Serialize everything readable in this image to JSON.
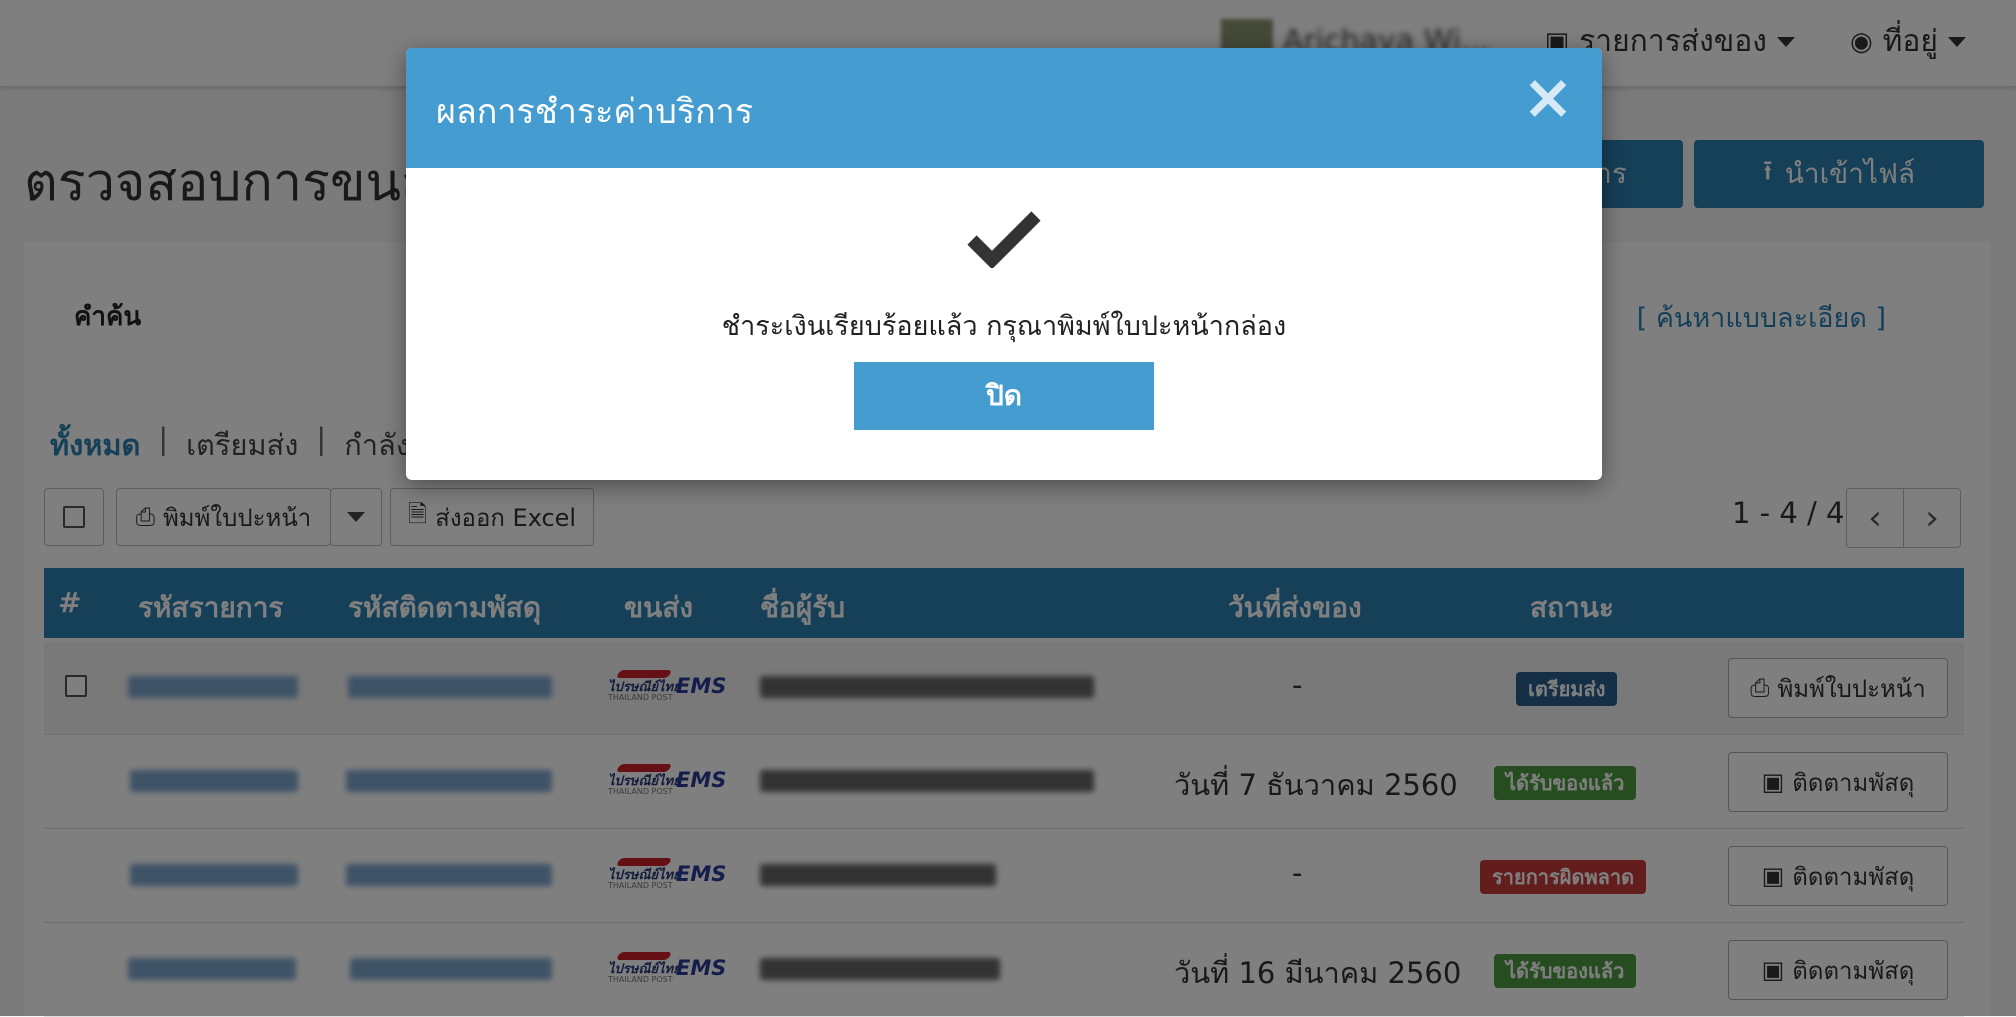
{
  "topnav": {
    "user_name": "Arichaya Wi...",
    "shipments_label": "รายการส่งของ",
    "address_label": "ที่อยู่"
  },
  "page": {
    "title": "ตรวจสอบการขนส่ง",
    "other_button_partial": "าร",
    "import_button": "นำเข้าไฟล์"
  },
  "search": {
    "label": "คำค้น",
    "advanced_link": "[ ค้นหาแบบละเอียด ]"
  },
  "filters": [
    {
      "label": "ทั้งหมด",
      "active": true
    },
    {
      "label": "เตรียมส่ง",
      "active": false
    },
    {
      "label": "กำลังจั",
      "active": false
    }
  ],
  "toolbar": {
    "print_label": "พิมพ์ใบปะหน้า",
    "export_label": "ส่งออก Excel",
    "pager_text": "1 - 4 / 4",
    "prev_icon": "‹",
    "next_icon": "›"
  },
  "table": {
    "headers": {
      "index": "#",
      "order_id": "รหัสรายการ",
      "tracking_id": "รหัสติดตามพัสดุ",
      "carrier": "ขนส่ง",
      "recipient": "ชื่อผู้รับ",
      "ship_date": "วันที่ส่งของ",
      "status": "สถานะ"
    },
    "carrier_logo": {
      "thai": "ไปรษณีย์ไทย",
      "sub": "THAILAND POST",
      "ems": "EMS"
    },
    "rows": [
      {
        "ship_date": "-",
        "status": "เตรียมส่ง",
        "status_color": "#2a5f8f",
        "action": "พิมพ์ใบปะหน้า",
        "action_icon": "print-icon"
      },
      {
        "ship_date": "วันที่ 7 ธันวาคม 2560",
        "status": "ได้รับของแล้ว",
        "status_color": "#4d9a3f",
        "action": "ติดตามพัสดุ",
        "action_icon": "box-icon"
      },
      {
        "ship_date": "-",
        "status": "รายการผิดพลาด",
        "status_color": "#c63a3a",
        "action": "ติดตามพัสดุ",
        "action_icon": "box-icon"
      },
      {
        "ship_date": "วันที่ 16 มีนาคม 2560",
        "status": "ได้รับของแล้ว",
        "status_color": "#4d9a3f",
        "action": "ติดตามพัสดุ",
        "action_icon": "box-icon"
      }
    ]
  },
  "modal": {
    "title": "ผลการชำระค่าบริการ",
    "close_icon": "×",
    "message": "ชำระเงินเรียบร้อยแล้ว กรุณาพิมพ์ใบปะหน้ากล่อง",
    "button": "ปิด"
  },
  "colors": {
    "primary": "#2c7fb1",
    "modal_header": "#449cd0"
  }
}
